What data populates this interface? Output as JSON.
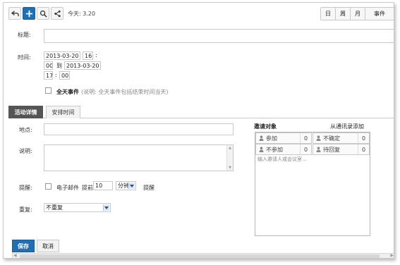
{
  "toolbar": {
    "back_icon": "undo-arrow-icon",
    "add_icon": "plus-icon",
    "search_icon": "search-icon",
    "share_icon": "share-icon",
    "today_label": "今天: 3.20",
    "views": [
      "日",
      "周",
      "月",
      "事件"
    ]
  },
  "form": {
    "title_label": "标题:",
    "title_value": "",
    "time_label": "时间:",
    "start_date": "2013-03-20",
    "start_hour": "16",
    "start_min": "00",
    "to_label": "到",
    "end_date": "2013-03-20",
    "end_hour": "17",
    "end_min": "00",
    "colon": ":",
    "allday_label": "全天事件",
    "allday_hint": "(说明: 全天事件包括结束时间当天)"
  },
  "tabs": [
    "活动详情",
    "安排时间"
  ],
  "details": {
    "location_label": "地点:",
    "location_value": "",
    "desc_label": "说明:",
    "desc_value": "",
    "reminder_label": "提醒:",
    "reminder_email_label": "电子邮件",
    "reminder_advance_label": "提前",
    "reminder_value": "10",
    "reminder_unit": "分钟",
    "reminder_suffix": "提醒",
    "repeat_label": "重复:",
    "repeat_value": "不重复"
  },
  "invite": {
    "title": "邀请对象",
    "add_from_contacts": "从通讯录添加",
    "attend_label": "参加",
    "attend_count": "0",
    "unsure_label": "不确定",
    "unsure_count": "0",
    "decline_label": "不参加",
    "decline_count": "0",
    "pending_label": "待回复",
    "pending_count": "0",
    "input_placeholder": "输入邀请人或会议室..."
  },
  "footer": {
    "save_label": "保存",
    "cancel_label": "取消"
  },
  "colors": {
    "primary": "#1f6fb2",
    "active_tab": "#555555"
  }
}
